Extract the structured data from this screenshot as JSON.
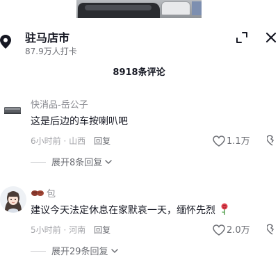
{
  "location": {
    "title": "驻马店市",
    "subtitle": "87.9万人打卡"
  },
  "comment_count": "8918条评论",
  "comments": [
    {
      "username": "快消品-岳公子",
      "text": "这是后边的车按喇叭吧",
      "time": "6小时前",
      "region": "山西",
      "reply_label": "回复",
      "likes": "1.1万",
      "expand_label": "展开8条回复"
    },
    {
      "username": "包",
      "text": "建议今天法定休息在家默哀一天，缅怀先烈",
      "time": "5小时前",
      "region": "河南",
      "reply_label": "回复",
      "likes": "2.0万",
      "expand_label": "展开29条回复"
    }
  ],
  "colors": {
    "text_primary": "#161823",
    "text_secondary": "#8a8b91",
    "text_muted": "#a1a2a7"
  },
  "icons": [
    "map-pin-icon",
    "expand-icon",
    "close-icon",
    "heart-icon",
    "dislike-icon",
    "chevron-down-icon",
    "rose-icon",
    "bean-emoji-icon"
  ]
}
